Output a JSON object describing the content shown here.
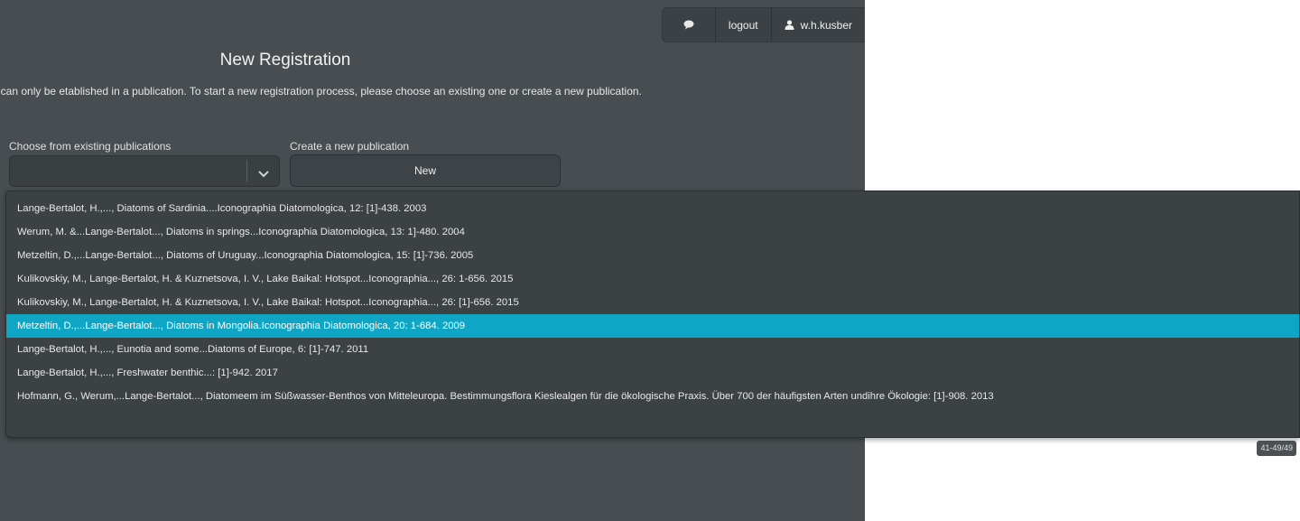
{
  "nav": {
    "logout_label": "logout",
    "user_label": "w.h.kusber"
  },
  "page": {
    "title": "New Registration",
    "intro": "t can only be etablished in a publication. To start a new registration process, please choose an existing one or create a new publication."
  },
  "form": {
    "existing_label": "Choose from existing publications",
    "existing_value": "",
    "new_label": "Create a new publication",
    "new_button": "New"
  },
  "dropdown": {
    "items": [
      {
        "label": "Lange-Bertalot, H.,..., Diatoms of Sardinia....Iconographia Diatomologica, 12: [1]-438. 2003",
        "selected": false
      },
      {
        "label": "Werum, M. &...Lange-Bertalot..., Diatoms in springs...Iconographia Diatomologica, 13: 1]-480. 2004",
        "selected": false
      },
      {
        "label": "Metzeltin, D.,...Lange-Bertalot..., Diatoms of Uruguay...Iconographia Diatomologica, 15: [1]-736. 2005",
        "selected": false
      },
      {
        "label": "Kulikovskiy, M., Lange-Bertalot, H. & Kuznetsova, I. V., Lake Baikal: Hotspot...Iconographia..., 26: 1-656. 2015",
        "selected": false
      },
      {
        "label": "Kulikovskiy, M., Lange-Bertalot, H. & Kuznetsova, I. V., Lake Baikal: Hotspot...Iconographia..., 26: [1]-656. 2015",
        "selected": false
      },
      {
        "label": "Metzeltin, D.,...Lange-Bertalot..., Diatoms in Mongolia.Iconographia Diatomologica, 20: 1-684. 2009",
        "selected": true
      },
      {
        "label": "Lange-Bertalot, H.,..., Eunotia and some...Diatoms of Europe, 6: [1]-747. 2011",
        "selected": false
      },
      {
        "label": "Lange-Bertalot, H.,..., Freshwater benthic...: [1]-942. 2017",
        "selected": false
      },
      {
        "label": "Hofmann, G., Werum,...Lange-Bertalot..., Diatomeem im Süßwasser-Benthos von Mitteleuropa. Bestimmungsflora Kieslealgen für die ökologische Praxis. Über 700 der häufigsten Arten undihre Ökologie: [1]-908. 2013",
        "selected": false
      }
    ],
    "pager": "41-49/49"
  },
  "icons": {
    "chat": "comment-icon",
    "user": "user-icon",
    "chevron": "chevron-down-icon"
  }
}
